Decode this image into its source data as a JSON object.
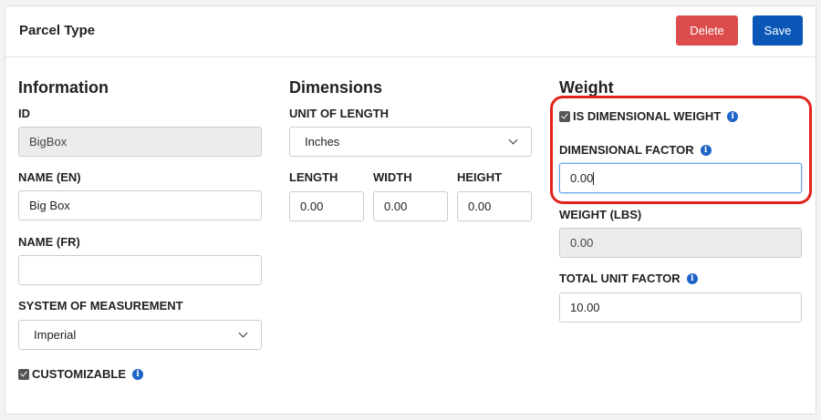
{
  "header": {
    "title": "Parcel Type",
    "delete_label": "Delete",
    "save_label": "Save"
  },
  "information": {
    "heading": "Information",
    "id_label": "ID",
    "id_value": "BigBox",
    "name_en_label": "NAME (EN)",
    "name_en_value": "Big Box",
    "name_fr_label": "NAME (FR)",
    "name_fr_value": "",
    "system_label": "SYSTEM OF MEASUREMENT",
    "system_value": "Imperial",
    "customizable_label": "CUSTOMIZABLE",
    "customizable_checked": true
  },
  "dimensions": {
    "heading": "Dimensions",
    "unit_label": "UNIT OF LENGTH",
    "unit_value": "Inches",
    "length_label": "LENGTH",
    "length_value": "0.00",
    "width_label": "WIDTH",
    "width_value": "0.00",
    "height_label": "HEIGHT",
    "height_value": "0.00"
  },
  "weight": {
    "heading": "Weight",
    "is_dimensional_label": "IS DIMENSIONAL WEIGHT",
    "is_dimensional_checked": true,
    "dimensional_factor_label": "DIMENSIONAL FACTOR",
    "dimensional_factor_value": "0.00",
    "weight_label": "WEIGHT (LBS)",
    "weight_value": "0.00",
    "total_unit_factor_label": "TOTAL UNIT FACTOR",
    "total_unit_factor_value": "10.00"
  },
  "colors": {
    "delete": "#dc4c4c",
    "save": "#0b57b8",
    "info_icon": "#1e63c7",
    "highlight": "#e2231a"
  }
}
